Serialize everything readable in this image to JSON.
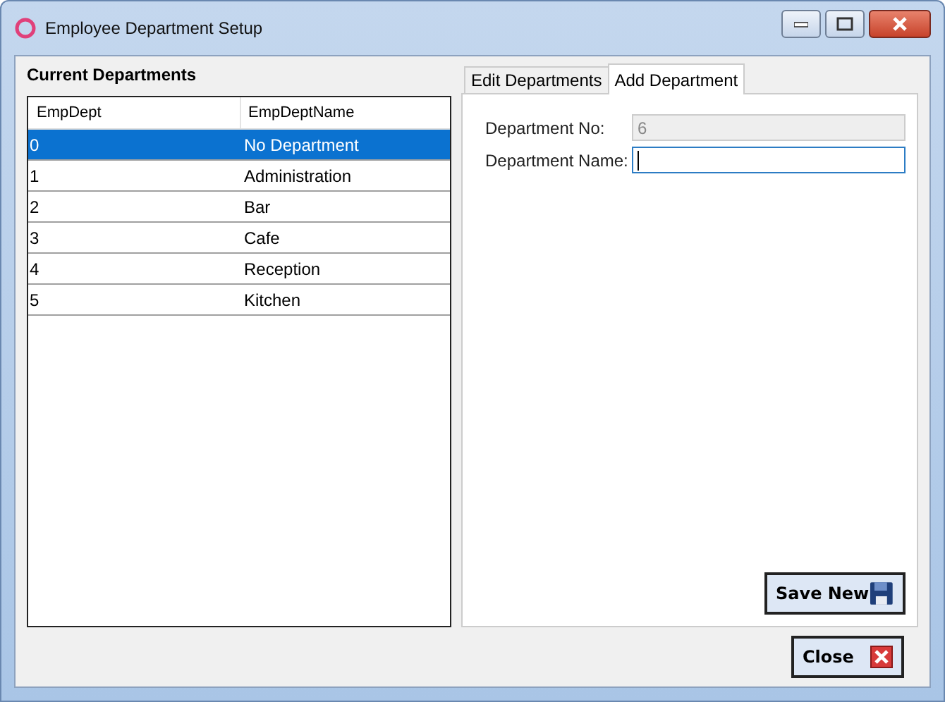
{
  "window": {
    "title": "Employee Department Setup"
  },
  "departments": {
    "heading": "Current Departments",
    "columns": [
      "EmpDept",
      "EmpDeptName"
    ],
    "rows": [
      {
        "cells": [
          "0",
          "No Department"
        ],
        "selected": true
      },
      {
        "cells": [
          "1",
          "Administration"
        ],
        "selected": false
      },
      {
        "cells": [
          "2",
          "Bar"
        ],
        "selected": false
      },
      {
        "cells": [
          "3",
          "Cafe"
        ],
        "selected": false
      },
      {
        "cells": [
          "4",
          "Reception"
        ],
        "selected": false
      },
      {
        "cells": [
          "5",
          "Kitchen"
        ],
        "selected": false
      }
    ]
  },
  "tabs": [
    {
      "label": "Edit Departments",
      "selected": false
    },
    {
      "label": "Add Department",
      "selected": true
    }
  ],
  "form": {
    "fields": [
      {
        "label": "Department No:",
        "value": "6",
        "disabled": true,
        "focused": false
      },
      {
        "label": "Department Name:",
        "disabled": false,
        "focused": true
      }
    ],
    "save_button": {
      "label": "Save New",
      "kind": "save"
    }
  },
  "close_button": {
    "label": "Close",
    "kind": "close"
  }
}
